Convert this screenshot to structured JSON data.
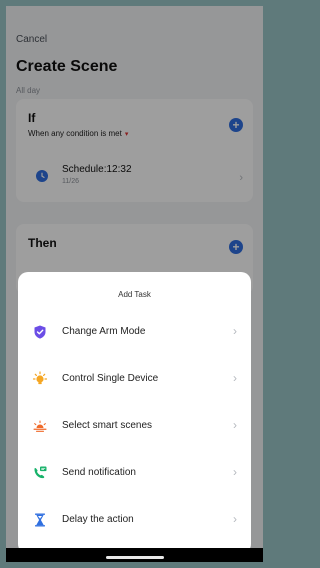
{
  "header": {
    "cancel_label": "Cancel",
    "title": "Create Scene",
    "subtitle": "All day"
  },
  "if_section": {
    "title": "If",
    "description": "When any condition is met",
    "condition": {
      "label": "Schedule:12:32",
      "sub": "11/26"
    }
  },
  "then_section": {
    "title": "Then"
  },
  "sheet": {
    "title": "Add Task",
    "items": [
      {
        "label": "Change Arm Mode",
        "icon": "shield-icon",
        "color": "#6b4de6"
      },
      {
        "label": "Control Single Device",
        "icon": "lightbulb-icon",
        "color": "#f5a623"
      },
      {
        "label": "Select smart scenes",
        "icon": "sunrise-icon",
        "color": "#f06a2a"
      },
      {
        "label": "Send notification",
        "icon": "phone-message-icon",
        "color": "#17b26a"
      },
      {
        "label": "Delay the action",
        "icon": "hourglass-icon",
        "color": "#2f6fe0"
      }
    ]
  },
  "colors": {
    "accent": "#2f6fe0",
    "backdrop": "#5f7a7b"
  }
}
